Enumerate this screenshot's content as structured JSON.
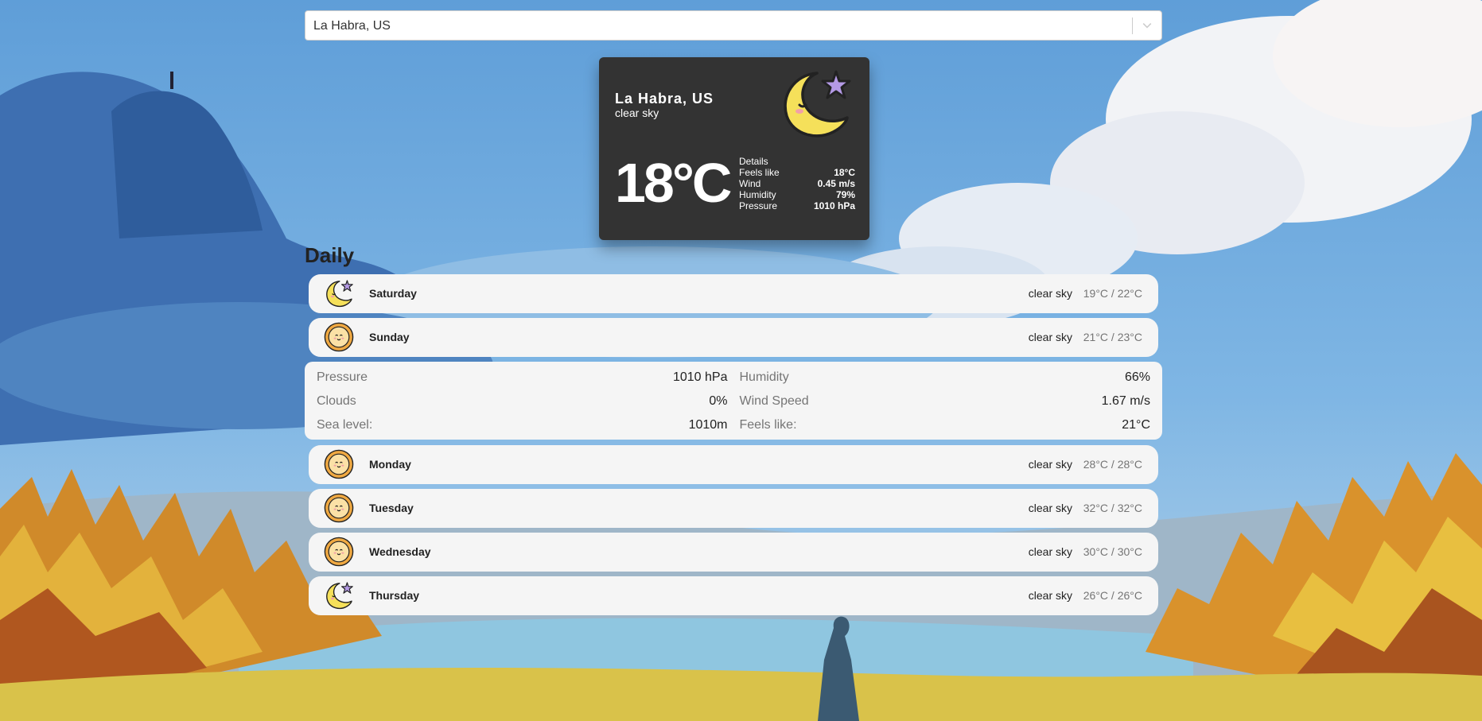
{
  "search": {
    "value": "La Habra, US"
  },
  "current": {
    "city": "La Habra, US",
    "description": "clear sky",
    "temperature": "18°C",
    "icon": "moon-star-icon",
    "details_title": "Details",
    "details": [
      {
        "label": "Feels like",
        "value": "18°C"
      },
      {
        "label": "Wind",
        "value": "0.45 m/s"
      },
      {
        "label": "Humidity",
        "value": "79%"
      },
      {
        "label": "Pressure",
        "value": "1010 hPa"
      }
    ]
  },
  "daily": {
    "title": "Daily",
    "days": [
      {
        "name": "Saturday",
        "description": "clear sky",
        "temps": "19°C / 22°C",
        "icon": "moon-star-icon"
      },
      {
        "name": "Sunday",
        "description": "clear sky",
        "temps": "21°C / 23°C",
        "icon": "sun-icon"
      },
      {
        "name": "Monday",
        "description": "clear sky",
        "temps": "28°C / 28°C",
        "icon": "sun-icon"
      },
      {
        "name": "Tuesday",
        "description": "clear sky",
        "temps": "32°C / 32°C",
        "icon": "sun-icon"
      },
      {
        "name": "Wednesday",
        "description": "clear sky",
        "temps": "30°C / 30°C",
        "icon": "sun-icon"
      },
      {
        "name": "Thursday",
        "description": "clear sky",
        "temps": "26°C / 26°C",
        "icon": "moon-star-icon"
      }
    ],
    "expanded_details": [
      {
        "label": "Pressure",
        "value": "1010 hPa"
      },
      {
        "label": "Humidity",
        "value": "66%"
      },
      {
        "label": "Clouds",
        "value": "0%"
      },
      {
        "label": "Wind Speed",
        "value": "1.67 m/s"
      },
      {
        "label": "Sea level:",
        "value": "1010m"
      },
      {
        "label": "Feels like:",
        "value": "21°C"
      }
    ]
  },
  "colors": {
    "card_dark": "#333333",
    "row_light": "#f5f5f5",
    "moon_yellow": "#f5e05a",
    "star_purple": "#b49ae6",
    "sun_orange": "#f0a942"
  }
}
